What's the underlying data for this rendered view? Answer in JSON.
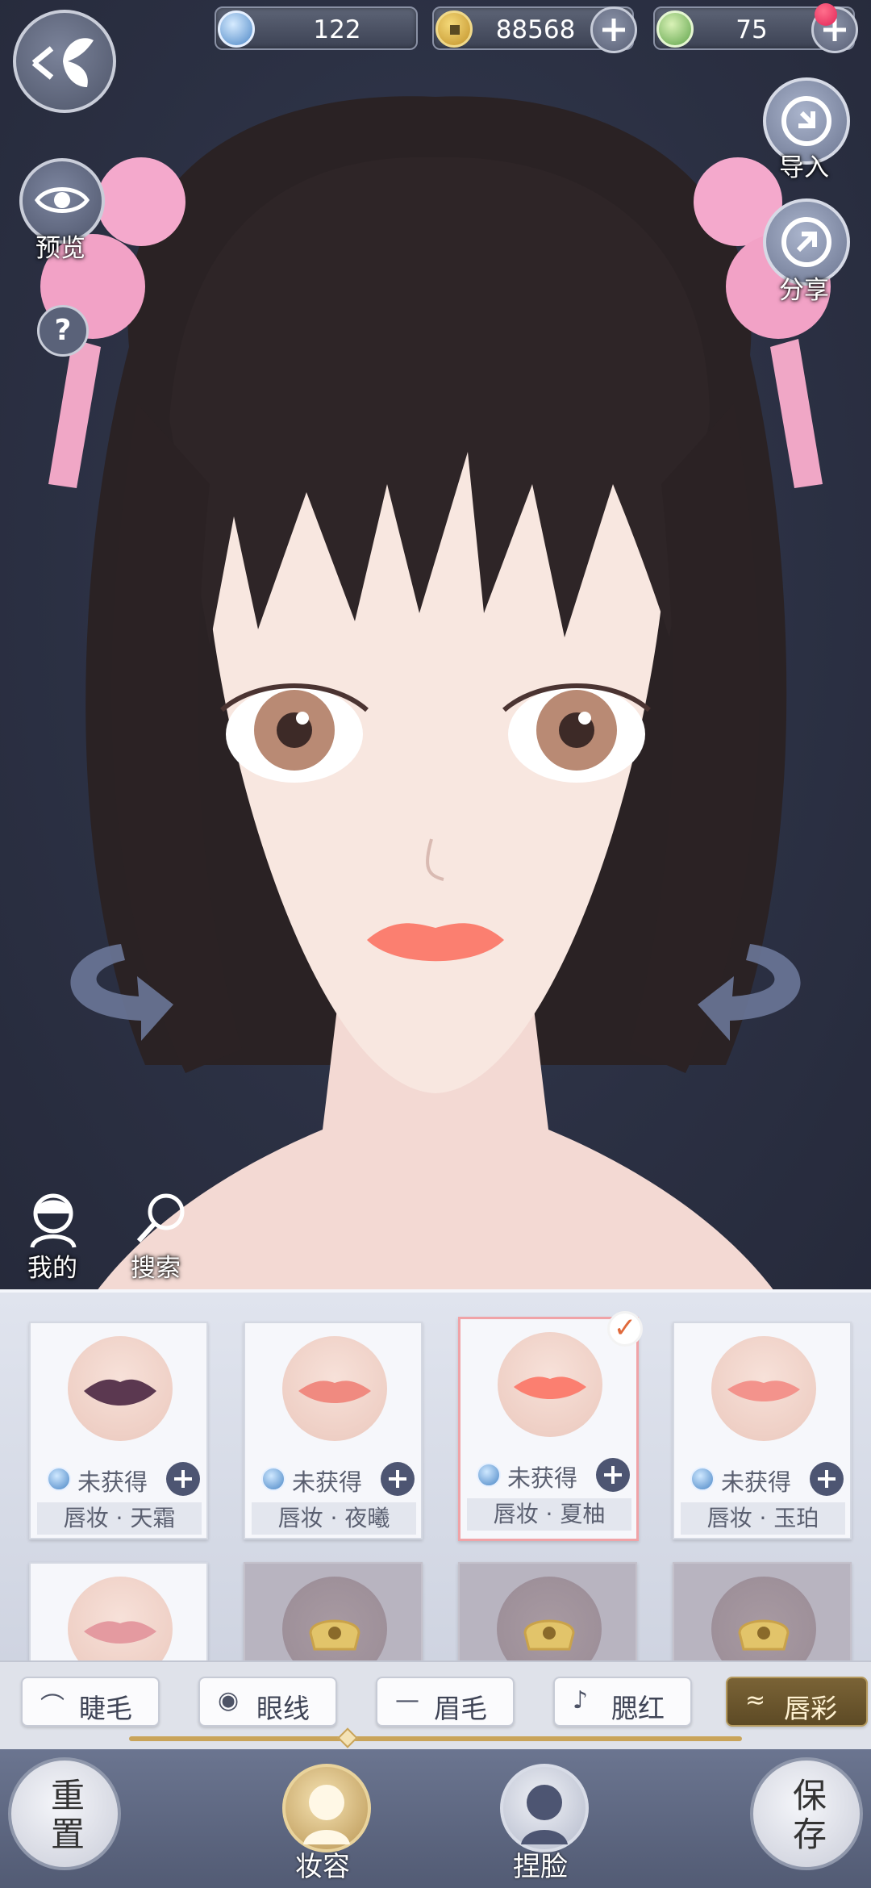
{
  "currency": {
    "gem_count": "122",
    "coin_count": "88568",
    "energy_count": "75"
  },
  "side_buttons": {
    "preview": "预览",
    "help": "?",
    "import": "导入",
    "share": "分享"
  },
  "quick_actions": {
    "mine": "我的",
    "search": "搜索"
  },
  "makeup_items": [
    {
      "status": "未获得",
      "name": "唇妆 · 天霜",
      "lip_color": "#5b3850",
      "selected": false
    },
    {
      "status": "未获得",
      "name": "唇妆 · 夜曦",
      "lip_color": "#f08a80",
      "selected": false
    },
    {
      "status": "未获得",
      "name": "唇妆 · 夏柚",
      "lip_color": "#fb7f70",
      "selected": true
    },
    {
      "status": "未获得",
      "name": "唇妆 · 玉珀",
      "lip_color": "#f3938c",
      "selected": false
    },
    {
      "lip_color": "#e49aa0",
      "locked": false
    },
    {
      "locked": true
    },
    {
      "locked": true
    },
    {
      "locked": true
    }
  ],
  "tabs": [
    {
      "label": "睫毛",
      "icon": "eyelash-icon"
    },
    {
      "label": "眼线",
      "icon": "eye-icon"
    },
    {
      "label": "眉毛",
      "icon": "eyebrow-icon"
    },
    {
      "label": "腮红",
      "icon": "blush-icon"
    },
    {
      "label": "唇彩",
      "icon": "lips-icon",
      "active": true
    }
  ],
  "bottom_nav": {
    "reset": "重置",
    "makeup": "妆容",
    "face": "捏脸",
    "save": "保存"
  },
  "colors": {
    "accent_gold": "#7a6336",
    "selected_border": "#f0a3a7",
    "background": "#2b3143"
  }
}
